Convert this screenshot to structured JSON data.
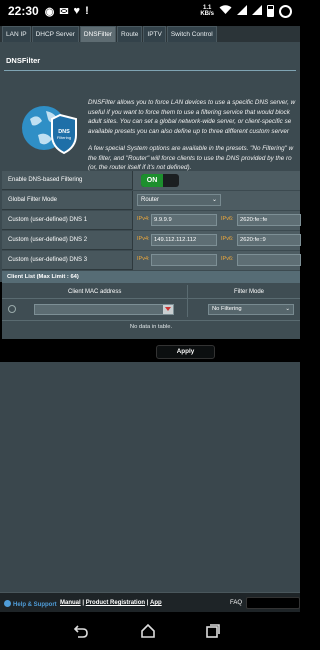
{
  "status_bar": {
    "time": "22:30",
    "icons": [
      "whatsapp-icon",
      "gmail-icon",
      "heart-icon",
      "alert-icon"
    ],
    "right_icons": [
      "data-speed-icon",
      "wifi-icon",
      "signal-icon",
      "signal-icon",
      "battery-icon",
      "ring-icon"
    ],
    "speed": "1.1",
    "speed_unit": "KB/s"
  },
  "tabs": [
    {
      "label": "LAN IP",
      "active": false
    },
    {
      "label": "DHCP Server",
      "active": false
    },
    {
      "label": "DNSFilter",
      "active": true
    },
    {
      "label": "Route",
      "active": false
    },
    {
      "label": "IPTV",
      "active": false
    },
    {
      "label": "Switch Control",
      "active": false
    }
  ],
  "panel": {
    "title": "DNSFilter",
    "logo_label": "DNS Filtering",
    "desc_lines": [
      "DNSFilter allows you to force LAN devices to use a specific DNS server, w",
      "useful if you want to force them to use a filtering service that would block",
      "adult sites. You can set a global network-wide server, or client-specific se",
      "available presets you can also define up to three different custom server"
    ],
    "desc_lines2": [
      "A few special System options are available in the presets. \"No Filtering\" w",
      "the filter, and \"Router\" will force clients to use the DNS provided by the ro",
      "(or, the router itself if it's not defined)."
    ]
  },
  "form": {
    "enable": {
      "label": "Enable DNS-based Filtering",
      "value": "ON"
    },
    "mode": {
      "label": "Global Filter Mode",
      "value": "Router"
    },
    "dns": [
      {
        "label": "Custom (user-defined) DNS 1",
        "ipv4_label": "IPv4:",
        "ipv4": "9.9.9.9",
        "ipv6_label": "IPv6:",
        "ipv6": "2620:fe::fe"
      },
      {
        "label": "Custom (user-defined) DNS 2",
        "ipv4_label": "IPv4:",
        "ipv4": "149.112.112.112",
        "ipv6_label": "IPv6:",
        "ipv6": "2620:fe::9"
      },
      {
        "label": "Custom (user-defined) DNS 3",
        "ipv4_label": "IPv4:",
        "ipv4": "",
        "ipv6_label": "IPv6:",
        "ipv6": ""
      }
    ]
  },
  "client_list": {
    "header": "Client List (Max Limit : 64)",
    "col_mac": "Client MAC address",
    "col_mode": "Filter Mode",
    "mode_value": "No Filtering",
    "empty": "No data in table."
  },
  "apply_label": "Apply",
  "footer": {
    "help": "Help & Support",
    "manual": "Manual",
    "sep1": " | ",
    "registration": "Product Registration",
    "sep2": " | ",
    "app": "App",
    "faq": "FAQ"
  },
  "colors": {
    "accent_on": "#1d8f2e",
    "ip_label": "#f0a93a",
    "link": "#4f9dd9"
  }
}
